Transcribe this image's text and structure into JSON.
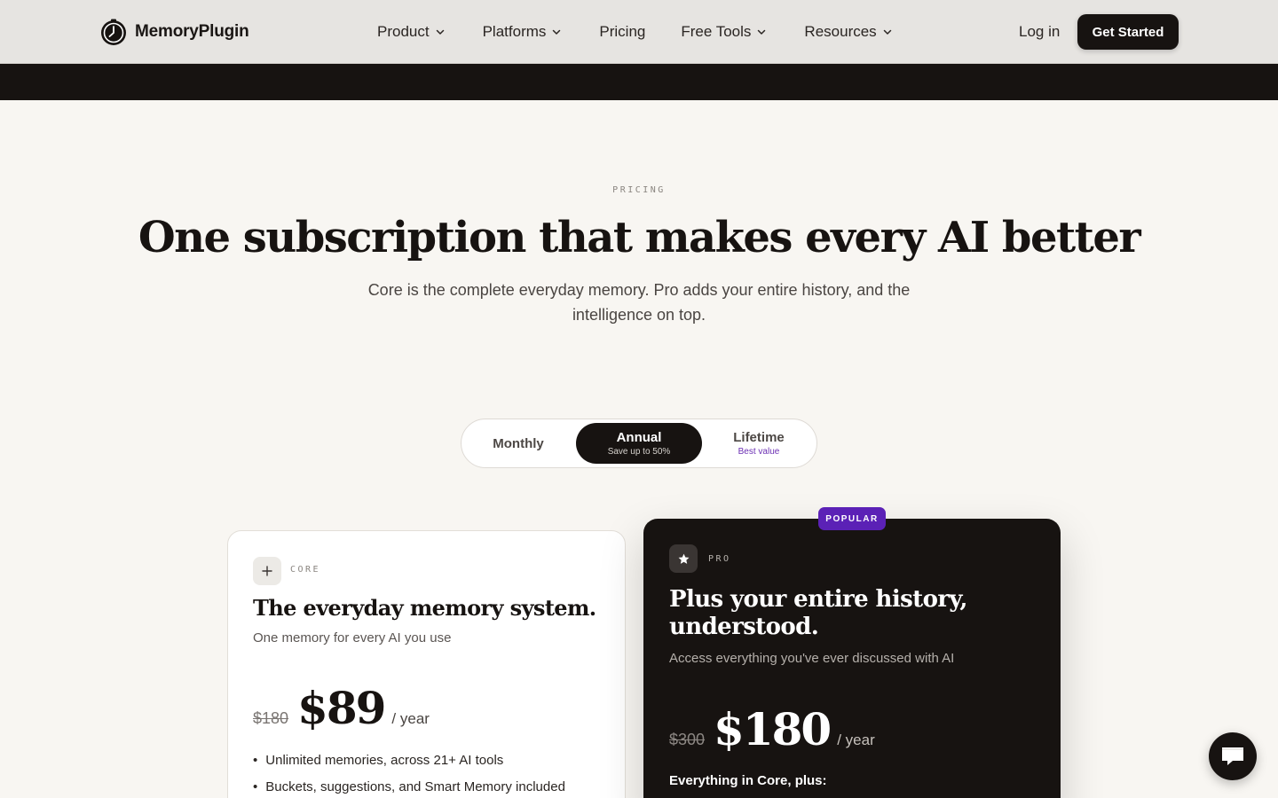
{
  "nav": {
    "logo_text": "MemoryPlugin",
    "items": [
      {
        "label": "Product",
        "has_dropdown": true
      },
      {
        "label": "Platforms",
        "has_dropdown": true
      },
      {
        "label": "Pricing",
        "has_dropdown": false
      },
      {
        "label": "Free Tools",
        "has_dropdown": true
      },
      {
        "label": "Resources",
        "has_dropdown": true
      }
    ],
    "login_label": "Log in",
    "cta_label": "Get Started"
  },
  "hero": {
    "eyebrow": "PRICING",
    "headline": "One subscription that makes every AI better",
    "subtitle": "Core is the complete everyday memory. Pro adds your entire history, and the intelligence on top."
  },
  "billing_toggle": {
    "monthly_label": "Monthly",
    "annual_label": "Annual",
    "annual_note": "Save up to 50%",
    "lifetime_label": "Lifetime",
    "lifetime_note": "Best value",
    "selected": "Annual"
  },
  "plans": {
    "core": {
      "tag": "CORE",
      "title": "The everyday memory system.",
      "description": "One memory for every AI you use",
      "old_price": "$180",
      "price": "$89",
      "period": "/ year",
      "features": [
        "Unlimited memories, across 21+ AI tools",
        "Buckets, suggestions, and Smart Memory included"
      ]
    },
    "pro": {
      "badge": "POPULAR",
      "tag": "PRO",
      "title": "Plus your entire history, understood.",
      "description": "Access everything you've ever discussed with AI",
      "old_price": "$300",
      "price": "$180",
      "period": "/ year",
      "features_heading": "Everything in Core, plus:"
    }
  },
  "colors": {
    "accent_dark": "#171311",
    "accent_purple": "#5b21b6",
    "background": "#f8f6f2"
  },
  "icons": [
    "memoryplugin-logo-icon",
    "chevron-down-icon",
    "plus-icon",
    "star-icon",
    "chat-icon"
  ]
}
